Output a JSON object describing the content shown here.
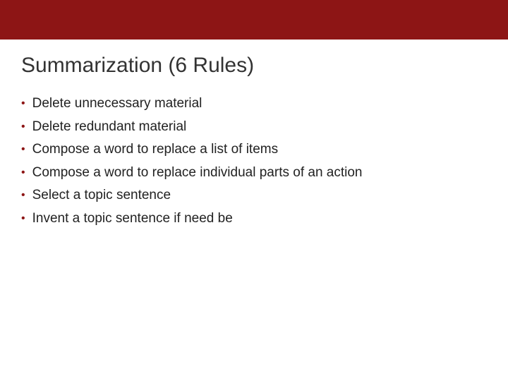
{
  "colors": {
    "accent": "#8d1515"
  },
  "title": "Summarization (6 Rules)",
  "bullets": [
    "Delete unnecessary material",
    "Delete redundant material",
    "Compose a word to replace a list of items",
    "Compose a word to replace individual parts of an action",
    "Select a topic sentence",
    "Invent a topic sentence if need be"
  ]
}
